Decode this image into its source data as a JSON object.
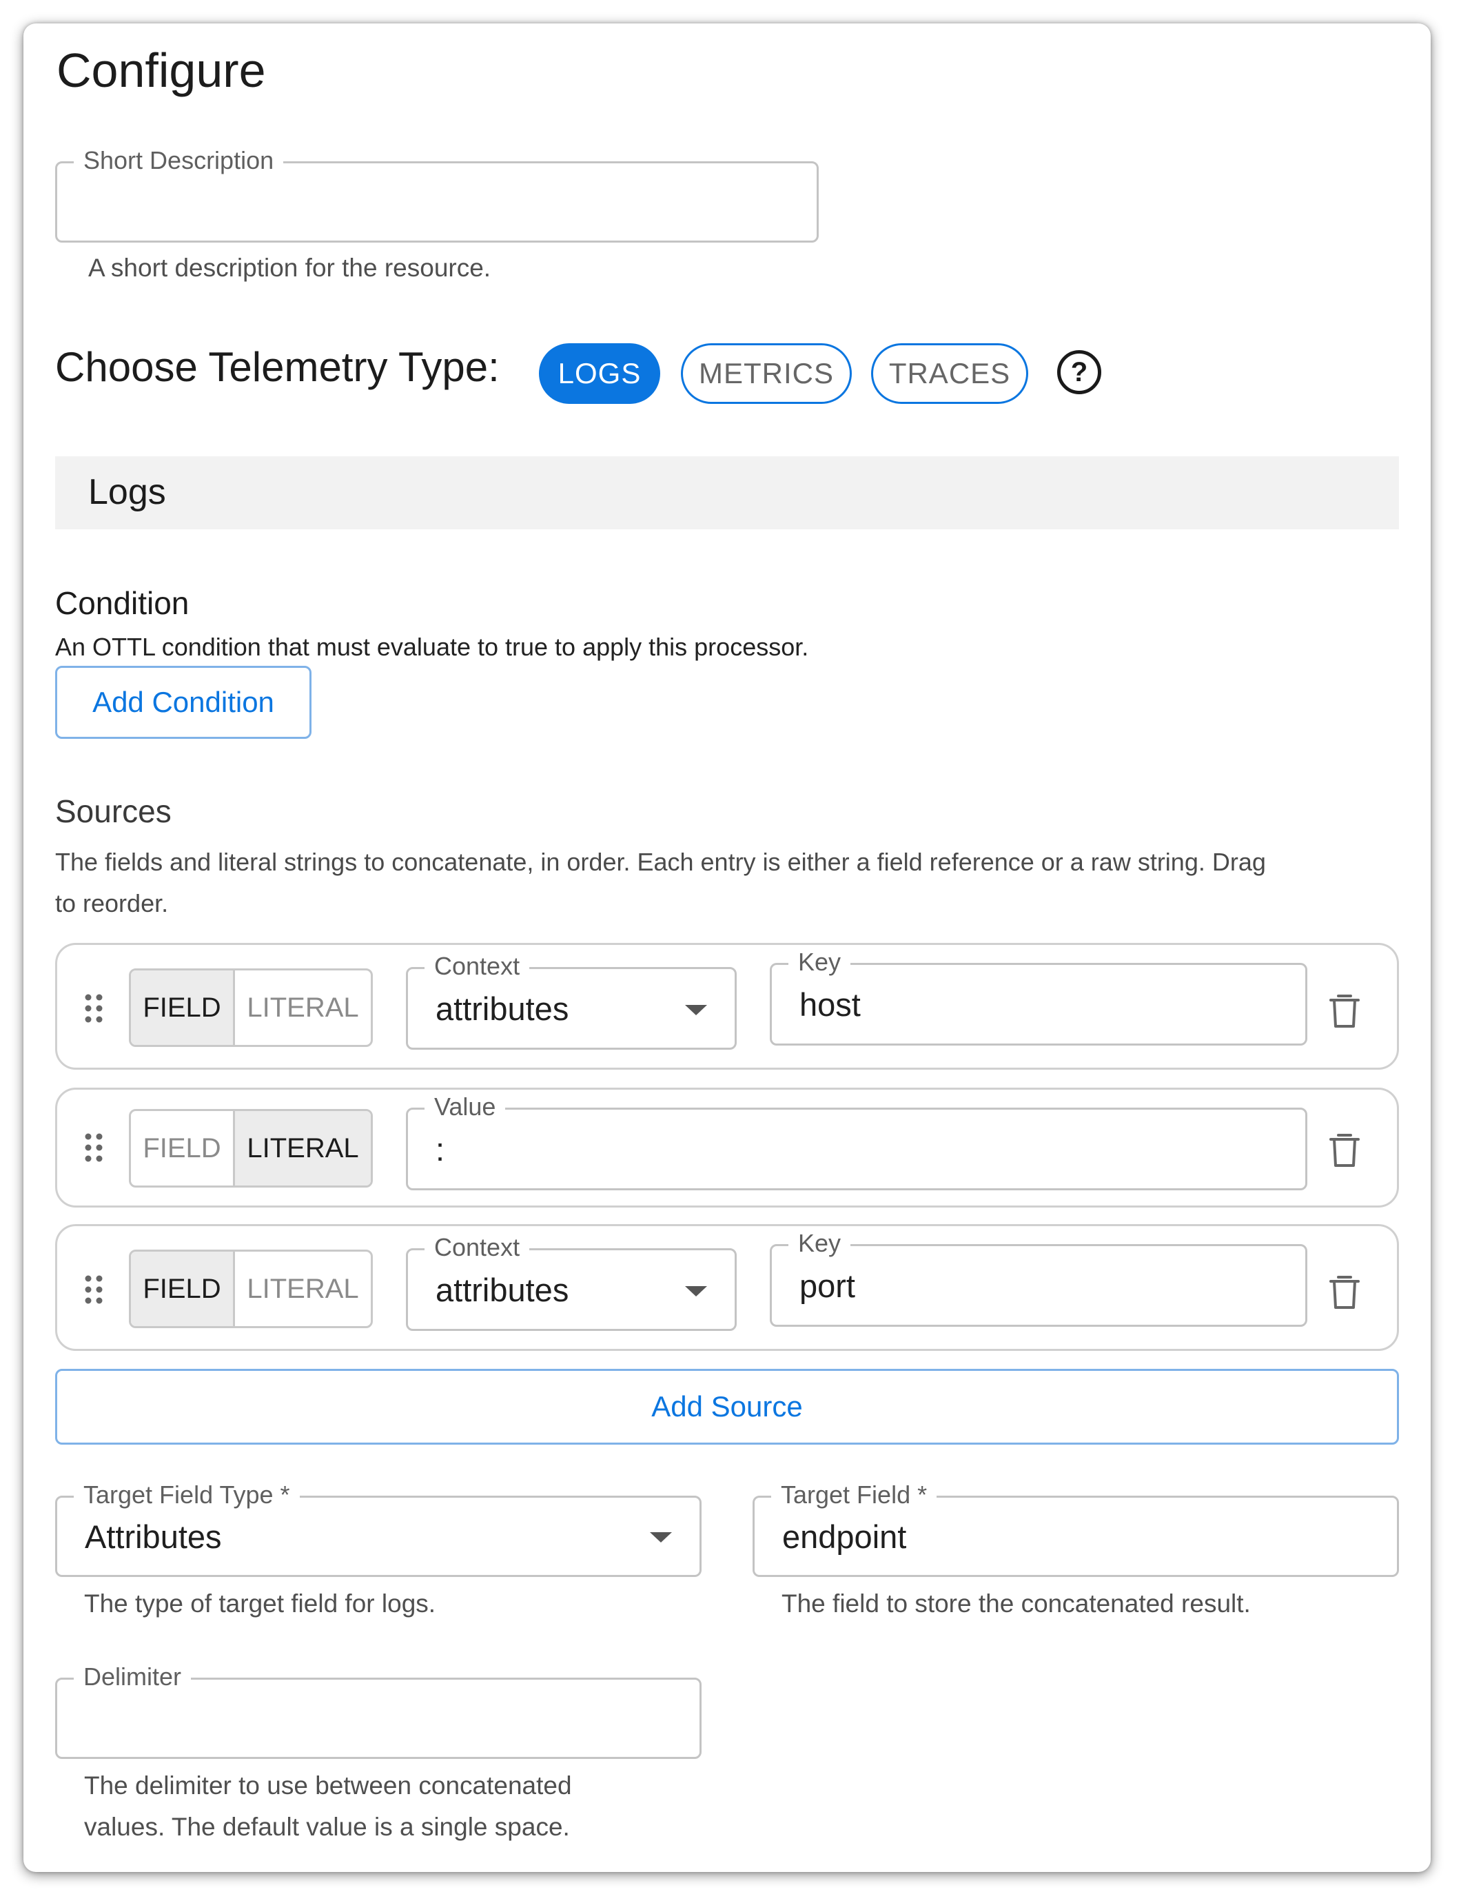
{
  "page": {
    "title": "Configure"
  },
  "short_description": {
    "label": "Short Description",
    "value": "",
    "help": "A short description for the resource."
  },
  "telemetry": {
    "label": "Choose Telemetry Type:",
    "options": [
      "LOGS",
      "METRICS",
      "TRACES"
    ],
    "selected": "LOGS",
    "help_icon": "question-circle-icon"
  },
  "logs_section": {
    "title": "Logs"
  },
  "condition": {
    "title": "Condition",
    "description": "An OTTL condition that must evaluate to true to apply this processor.",
    "button": "Add Condition"
  },
  "sources": {
    "title": "Sources",
    "description_line1": "The fields and literal strings to concatenate, in order. Each entry is either a field reference or a raw string. Drag",
    "description_line2": "to reorder.",
    "toggle_field": "FIELD",
    "toggle_literal": "LITERAL",
    "items": [
      {
        "mode": "FIELD",
        "context_label": "Context",
        "context_value": "attributes",
        "key_label": "Key",
        "key_value": "host"
      },
      {
        "mode": "LITERAL",
        "value_label": "Value",
        "value": ":"
      },
      {
        "mode": "FIELD",
        "context_label": "Context",
        "context_value": "attributes",
        "key_label": "Key",
        "key_value": "port"
      }
    ],
    "add_button": "Add Source"
  },
  "target_field_type": {
    "label": "Target Field Type *",
    "value": "Attributes",
    "help": "The type of target field for logs."
  },
  "target_field": {
    "label": "Target Field *",
    "value": "endpoint",
    "help": "The field to store the concatenated result."
  },
  "delimiter": {
    "label": "Delimiter",
    "value": "",
    "help_line1": "The delimiter to use between concatenated",
    "help_line2": "values. The default value is a single space."
  },
  "colors": {
    "accent": "#0b76e0",
    "border": "#c4c4c4",
    "section_bg": "#f2f2f2"
  }
}
